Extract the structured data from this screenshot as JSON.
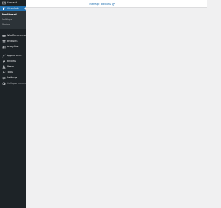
{
  "sidebar": {
    "items": [
      {
        "label": "Contact",
        "icon": "contact-icon"
      },
      {
        "label": "Cleantalk",
        "icon": "filter-icon",
        "active": true
      },
      {
        "label": "WooCommerce",
        "icon": "woocommerce-icon"
      },
      {
        "label": "Products",
        "icon": "archive-icon"
      },
      {
        "label": "Analytics",
        "icon": "analytics-icon"
      },
      {
        "label": "Appearance",
        "icon": "brush-icon"
      },
      {
        "label": "Plugins",
        "icon": "plugin-icon"
      },
      {
        "label": "Users",
        "icon": "users-icon"
      },
      {
        "label": "Tools",
        "icon": "wrench-icon"
      },
      {
        "label": "Settings",
        "icon": "settings-icon"
      },
      {
        "label": "Collapse menu",
        "icon": "collapse-icon"
      }
    ],
    "submenu": [
      {
        "label": "Dashboard",
        "current": true
      },
      {
        "label": "Settings"
      },
      {
        "label": "Status"
      }
    ]
  },
  "topbar": {
    "manage_link": "Manage add-ons"
  },
  "colors": {
    "sidebar_bg": "#1d2327",
    "active": "#2271b1",
    "content_bg": "#f0f0f1",
    "link": "#2271b1"
  }
}
